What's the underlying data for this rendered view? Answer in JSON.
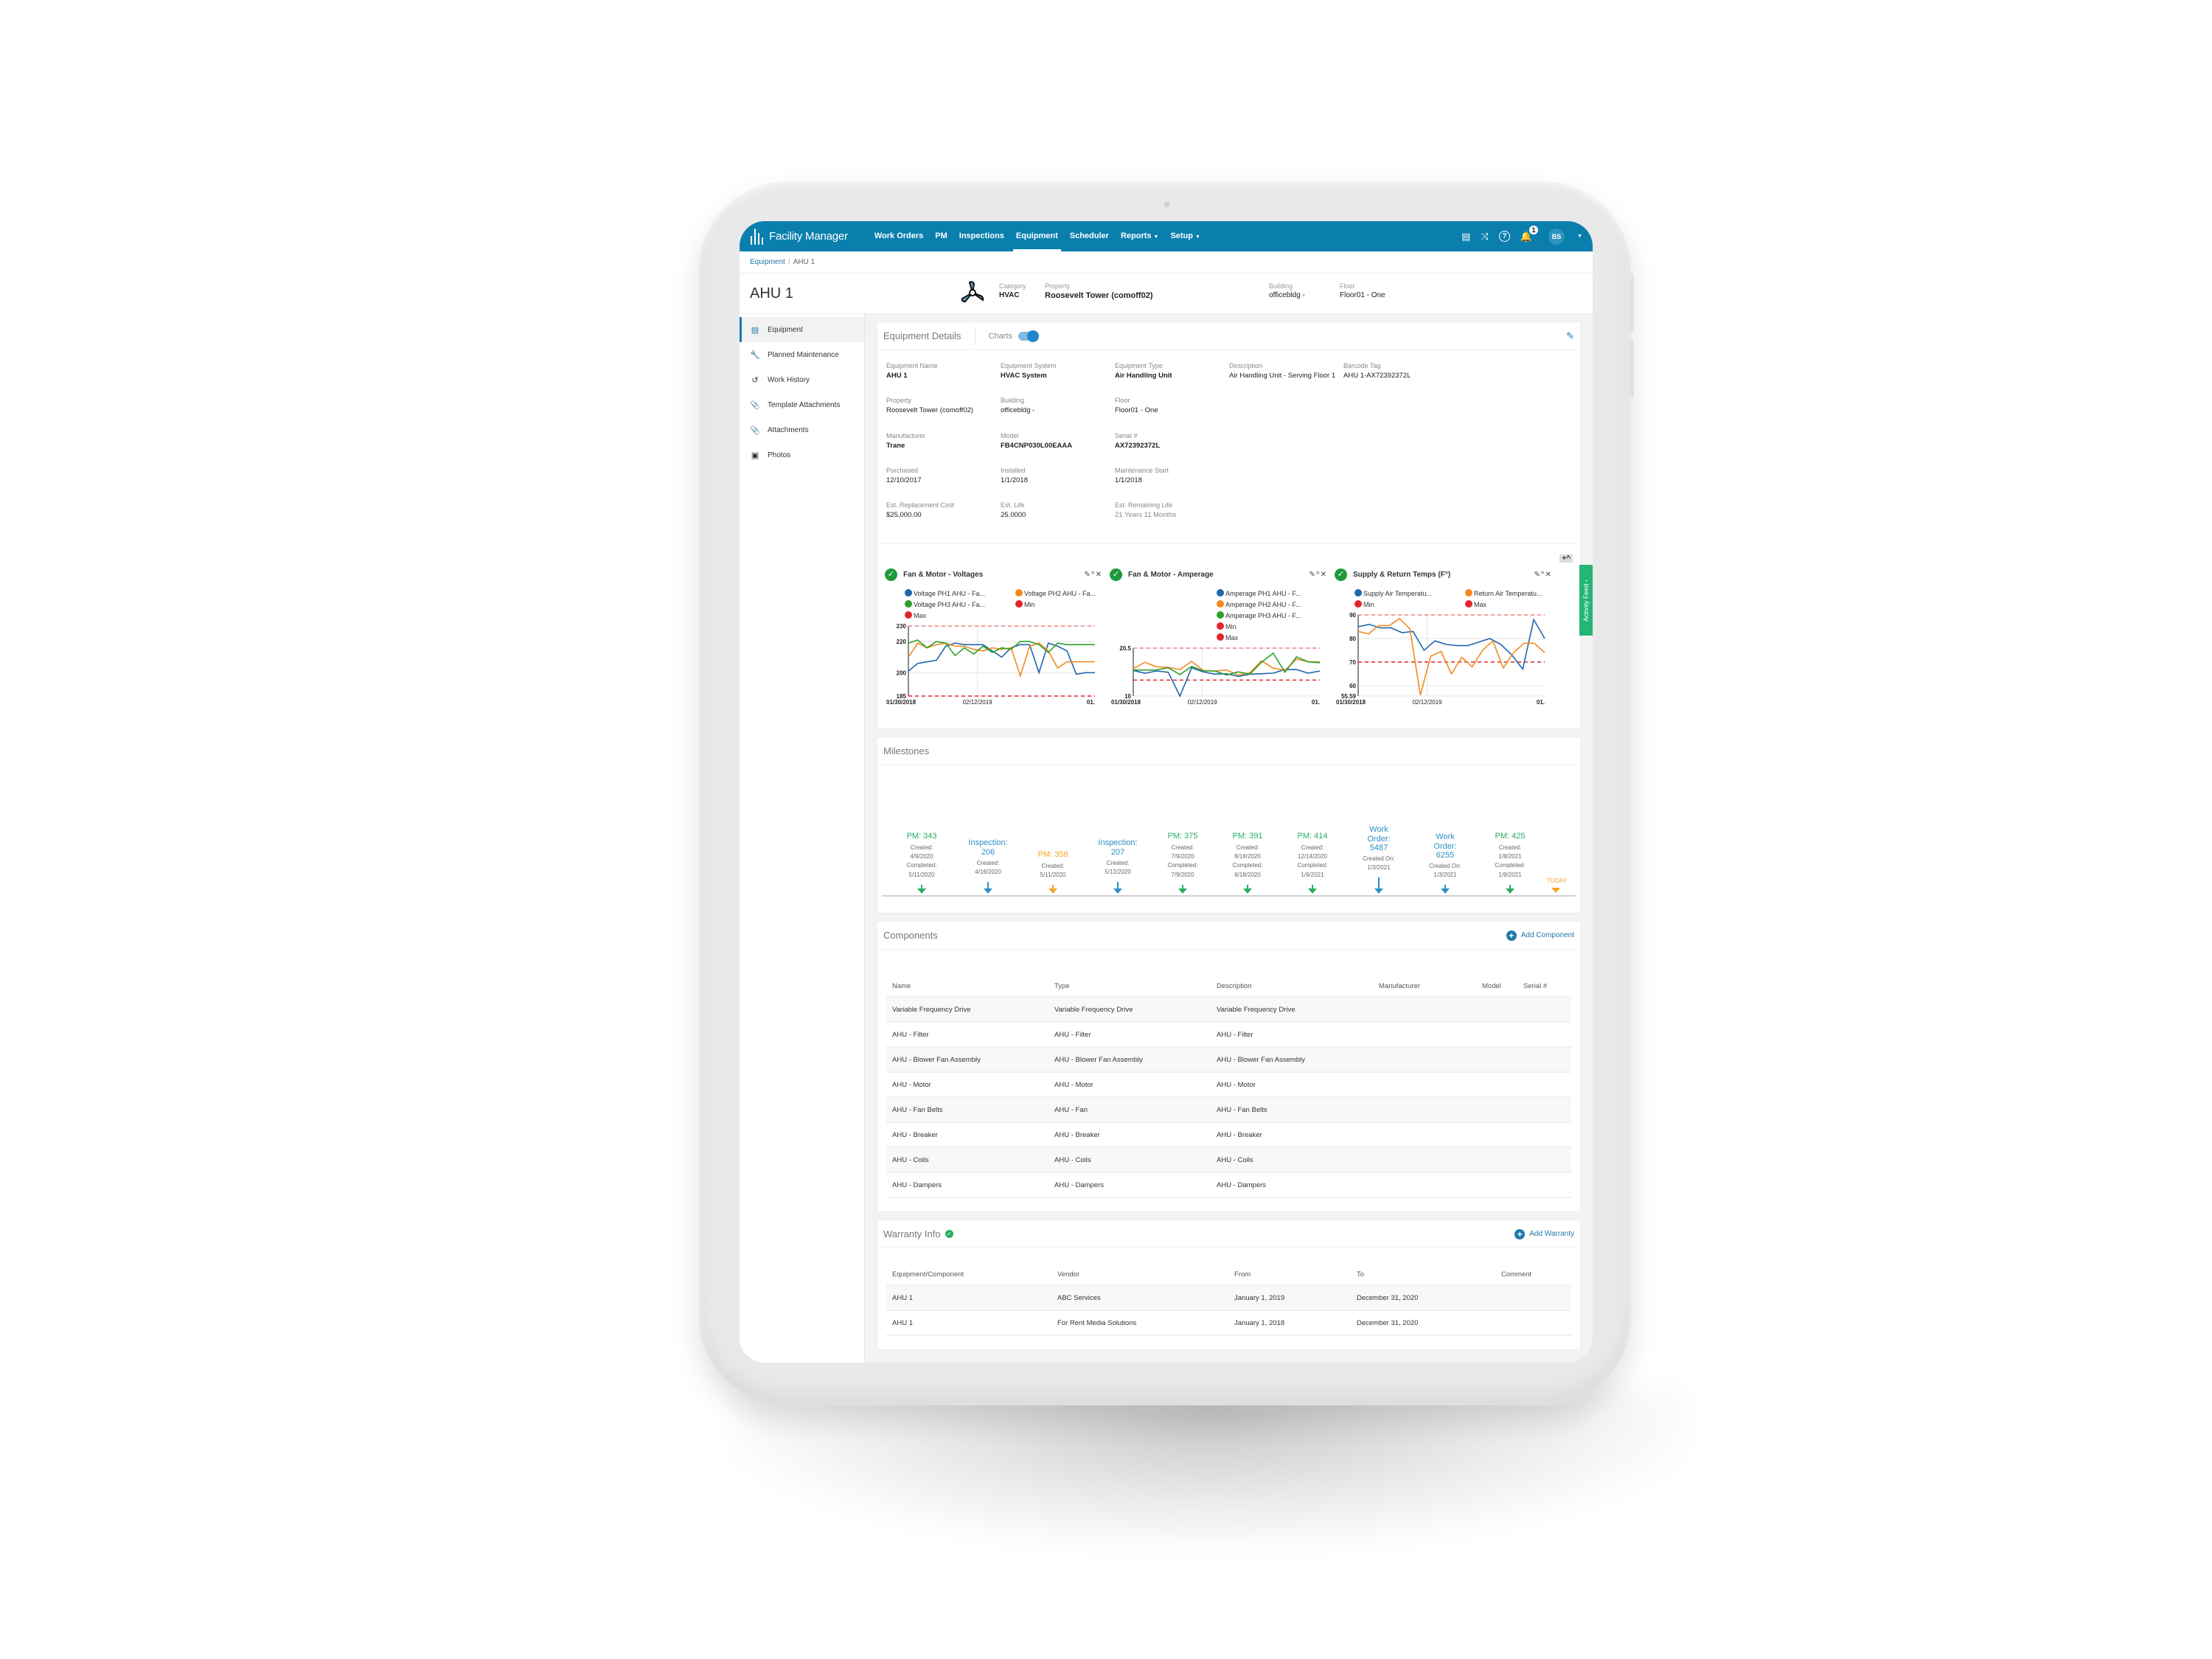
{
  "app": {
    "brand": "Facility Manager",
    "nav": [
      {
        "label": "Work Orders",
        "active": false,
        "caret": false
      },
      {
        "label": "PM",
        "active": false,
        "caret": false
      },
      {
        "label": "Inspections",
        "active": false,
        "caret": false
      },
      {
        "label": "Equipment",
        "active": true,
        "caret": false
      },
      {
        "label": "Scheduler",
        "active": false,
        "caret": false
      },
      {
        "label": "Reports",
        "active": false,
        "caret": true
      },
      {
        "label": "Setup",
        "active": false,
        "caret": true
      }
    ],
    "right_icons": [
      "database-icon",
      "shuffle-icon",
      "help-icon",
      "bell-icon"
    ],
    "notification_count": "1",
    "user_initials": "BS",
    "colors": {
      "brand": "#0a7fad",
      "link": "#1f78ad",
      "green": "#22b573",
      "orange": "#f5a623",
      "blue": "#2b8fc6",
      "pm_green": "#27ae60"
    }
  },
  "breadcrumb": {
    "parent": "Equipment",
    "separator": "/",
    "current": "AHU 1"
  },
  "header": {
    "title": "AHU 1",
    "category_label": "Category",
    "category": "HVAC",
    "property_label": "Property",
    "property": "Roosevelt Tower (comoff02)",
    "building_label": "Building",
    "building": "officebldg -",
    "floor_label": "Floor",
    "floor": "Floor01 - One"
  },
  "sidebar": {
    "items": [
      {
        "label": "Equipment",
        "icon": "list-icon",
        "glyph": "▤",
        "active": true
      },
      {
        "label": "Planned Maintenance",
        "icon": "wrench-icon",
        "glyph": "🔧",
        "active": false
      },
      {
        "label": "Work History",
        "icon": "history-icon",
        "glyph": "↺",
        "active": false
      },
      {
        "label": "Template Attachments",
        "icon": "paperclip-icon",
        "glyph": "📎",
        "active": false
      },
      {
        "label": "Attachments",
        "icon": "paperclip-icon",
        "glyph": "📎",
        "active": false
      },
      {
        "label": "Photos",
        "icon": "image-icon",
        "glyph": "▣",
        "active": false
      }
    ]
  },
  "details": {
    "title": "Equipment Details",
    "charts_label": "Charts",
    "charts_enabled": true,
    "fields": [
      {
        "label": "Equipment Name",
        "value": "AHU 1",
        "bold": true
      },
      {
        "label": "Equipment System",
        "value": "HVAC System",
        "bold": true
      },
      {
        "label": "Equipment Type",
        "value": "Air Handling Unit",
        "bold": true
      },
      {
        "label": "Description",
        "value": "Air Handling Unit - Serving Floor 1",
        "bold": false
      },
      {
        "label": "Barcode Tag",
        "value": "AHU 1-AX72392372L",
        "bold": false
      },
      {
        "label": "Property",
        "value": "Roosevelt Tower (comoff02)",
        "bold": false
      },
      {
        "label": "Building",
        "value": "officebldg -",
        "bold": false
      },
      {
        "label": "Floor",
        "value": "Floor01 - One",
        "bold": false
      },
      null,
      null,
      {
        "label": "Manufacturer",
        "value": "Trane",
        "bold": true
      },
      {
        "label": "Model",
        "value": "FB4CNP030L00EAAA",
        "bold": true
      },
      {
        "label": "Serial #",
        "value": "AX72392372L",
        "bold": true
      },
      null,
      null,
      {
        "label": "Purchased",
        "value": "12/10/2017",
        "bold": false
      },
      {
        "label": "Installed",
        "value": "1/1/2018",
        "bold": false
      },
      {
        "label": "Maintenance Start",
        "value": "1/1/2018",
        "bold": false
      },
      null,
      null,
      {
        "label": "Est. Replacement Cost",
        "value": "$25,000.00",
        "bold": false
      },
      {
        "label": "Est. Life",
        "value": "25.0000",
        "bold": false
      },
      {
        "label": "Est. Remaining Life",
        "value": "21 Years 11 Months",
        "bold": false,
        "muted": true
      }
    ]
  },
  "activity_feed": "Activity Feed",
  "chart_data": [
    {
      "type": "line",
      "title": "Fan & Motor - Voltages",
      "status": "ok",
      "ylim": [
        185,
        230
      ],
      "yticks": [
        185,
        200,
        220,
        230
      ],
      "xticks": [
        "01/30/2018",
        "02/12/2019",
        "01."
      ],
      "thresholds": {
        "min": 185,
        "max": 230
      },
      "series": [
        {
          "name": "Voltage PH1 AHU - Fa...",
          "color": "#2166ac",
          "values": [
            201,
            206,
            207,
            208,
            217,
            219,
            218,
            218,
            218,
            214,
            210,
            216,
            218,
            218,
            200,
            219,
            217,
            214,
            199,
            200,
            200
          ]
        },
        {
          "name": "Voltage PH2 AHU - Fa...",
          "color": "#f28a1e",
          "values": [
            210,
            219,
            216,
            218,
            219,
            217,
            217,
            215,
            214,
            216,
            215,
            216,
            198,
            217,
            219,
            214,
            203,
            207,
            207,
            207,
            207
          ]
        },
        {
          "name": "Voltage PH3 AHU - Fa...",
          "color": "#2ca02c",
          "values": [
            219,
            221,
            216,
            220,
            219,
            211,
            216,
            212,
            217,
            213,
            216,
            215,
            220,
            220,
            218,
            213,
            219,
            218,
            218,
            218,
            218
          ]
        },
        {
          "name": "Min",
          "color": "#e3242b",
          "values": []
        },
        {
          "name": "Max",
          "color": "#e3242b",
          "values": []
        }
      ]
    },
    {
      "type": "line",
      "title": "Fan & Motor - Amperage",
      "status": "ok",
      "ylim": [
        10,
        20.5
      ],
      "yticks": [
        10,
        20.5
      ],
      "xticks": [
        "01/30/2018",
        "02/12/2019",
        "01."
      ],
      "thresholds": {
        "min": 13.5,
        "max": 20.5
      },
      "series": [
        {
          "name": "Amperage PH1 AHU - F...",
          "color": "#2166ac",
          "values": [
            15.6,
            15,
            15.5,
            15.2,
            10,
            16.2,
            15.3,
            14.8,
            14.9,
            14.3,
            14.8,
            14.9,
            15,
            15.8,
            15.8,
            15,
            15.5
          ]
        },
        {
          "name": "Amperage PH2 AHU - F...",
          "color": "#f28a1e",
          "values": [
            16,
            17.4,
            16.4,
            16.3,
            15.8,
            17.6,
            15.6,
            15.5,
            15.7,
            14.6,
            15.1,
            17.7,
            16.1,
            15.6,
            18.1,
            17.5,
            17.5
          ]
        },
        {
          "name": "Amperage PH3 AHU - F...",
          "color": "#2ca02c",
          "values": [
            15.7,
            15.7,
            15.7,
            16.2,
            14.7,
            16.5,
            15.5,
            15.5,
            14.6,
            15.3,
            14.8,
            17.4,
            19.4,
            15.2,
            18.6,
            17.5,
            17.3
          ]
        },
        {
          "name": "Min",
          "color": "#e3242b",
          "values": []
        },
        {
          "name": "Max",
          "color": "#e3242b",
          "values": []
        }
      ]
    },
    {
      "type": "line",
      "title": "Supply & Return Temps (F°)",
      "status": "ok",
      "ylim": [
        55.59,
        90
      ],
      "yticks": [
        55.59,
        60,
        70,
        80,
        90
      ],
      "xticks": [
        "01/30/2018",
        "02/12/2019",
        "01."
      ],
      "thresholds": {
        "min": 70,
        "max": 90
      },
      "series": [
        {
          "name": "Supply Air Temperatu...",
          "color": "#2166ac",
          "values": [
            85,
            86,
            84.5,
            84.5,
            82.5,
            83,
            75,
            79,
            77.5,
            77,
            77,
            78.5,
            80,
            77.5,
            73,
            67,
            88,
            80
          ]
        },
        {
          "name": "Return Air Temperatu...",
          "color": "#f28a1e",
          "values": [
            83,
            82,
            85.5,
            85.5,
            88.5,
            84,
            56,
            72.5,
            74.5,
            65,
            72,
            68,
            75,
            79,
            67.5,
            74,
            78,
            78,
            74
          ]
        },
        {
          "name": "Min",
          "color": "#e3242b",
          "values": []
        },
        {
          "name": "Max",
          "color": "#e3242b",
          "values": []
        }
      ]
    }
  ],
  "milestones": {
    "title": "Milestones",
    "today_label": "TODAY",
    "items": [
      {
        "title": "PM: 343",
        "kind": "pm",
        "color": "#27ae60",
        "lines": [
          "Created:",
          "4/9/2020",
          "Completed:",
          "5/11/2020"
        ]
      },
      {
        "title": "Inspection: 206",
        "kind": "inspection",
        "color": "#2b8fc6",
        "lines": [
          "Created:",
          "4/16/2020"
        ]
      },
      {
        "title": "PM: 358",
        "kind": "pm-open",
        "color": "#f5a623",
        "lines": [
          "Created:",
          "5/11/2020"
        ]
      },
      {
        "title": "Inspection: 207",
        "kind": "inspection",
        "color": "#2b8fc6",
        "lines": [
          "Created:",
          "5/12/2020"
        ]
      },
      {
        "title": "PM: 375",
        "kind": "pm",
        "color": "#27ae60",
        "lines": [
          "Created:",
          "7/9/2020",
          "Completed:",
          "7/9/2020"
        ]
      },
      {
        "title": "PM: 391",
        "kind": "pm",
        "color": "#27ae60",
        "lines": [
          "Created:",
          "8/18/2020",
          "Completed:",
          "8/18/2020"
        ]
      },
      {
        "title": "PM: 414",
        "kind": "pm",
        "color": "#27ae60",
        "lines": [
          "Created:",
          "12/14/2020",
          "Completed:",
          "1/6/2021"
        ]
      },
      {
        "title": "Work Order: 5487",
        "kind": "work-order",
        "color": "#2b8fc6",
        "lines": [
          "Created On:",
          "1/3/2021"
        ]
      },
      {
        "title": "Work Order: 6255",
        "kind": "work-order",
        "color": "#2b8fc6",
        "lines": [
          "Created On:",
          "1/3/2021"
        ]
      },
      {
        "title": "PM: 425",
        "kind": "pm",
        "color": "#27ae60",
        "lines": [
          "Created:",
          "1/8/2021",
          "Completed:",
          "1/8/2021"
        ]
      }
    ]
  },
  "components": {
    "title": "Components",
    "add_label": "Add Component",
    "columns": [
      "Name",
      "Type",
      "Description",
      "Manufacturer",
      "Model",
      "Serial #"
    ],
    "rows": [
      [
        "Variable Frequency Drive",
        "Variable Frequency Drive",
        "Variable Frequency Drive",
        "",
        "",
        ""
      ],
      [
        "AHU - Filter",
        "AHU - Filter",
        "AHU - Filter",
        "",
        "",
        ""
      ],
      [
        "AHU - Blower Fan Assembly",
        "AHU - Blower Fan Assembly",
        "AHU - Blower Fan Assembly",
        "",
        "",
        ""
      ],
      [
        "AHU - Motor",
        "AHU - Motor",
        "AHU - Motor",
        "",
        "",
        ""
      ],
      [
        "AHU - Fan Belts",
        "AHU - Fan",
        "AHU - Fan Belts",
        "",
        "",
        ""
      ],
      [
        "AHU - Breaker",
        "AHU - Breaker",
        "AHU - Breaker",
        "",
        "",
        ""
      ],
      [
        "AHU - Coils",
        "AHU - Coils",
        "AHU - Coils",
        "",
        "",
        ""
      ],
      [
        "AHU - Dampers",
        "AHU - Dampers",
        "AHU - Dampers",
        "",
        "",
        ""
      ]
    ]
  },
  "warranty": {
    "title": "Warranty Info",
    "add_label": "Add Warranty",
    "columns": [
      "Equipment/Component",
      "Vendor",
      "From",
      "To",
      "Comment"
    ],
    "rows": [
      [
        "AHU 1",
        "ABC Services",
        "January 1, 2019",
        "December 31, 2020",
        ""
      ],
      [
        "AHU 1",
        "For Rent Media Solutions",
        "January 1, 2018",
        "December 31, 2020",
        ""
      ]
    ]
  }
}
